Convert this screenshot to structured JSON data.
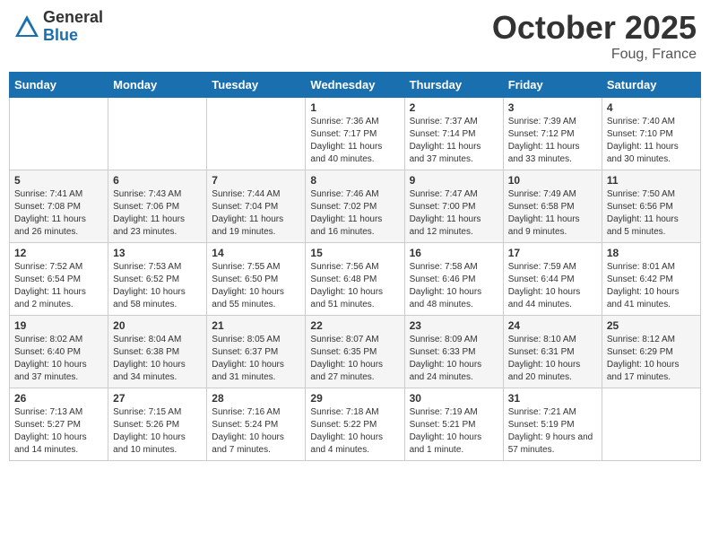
{
  "header": {
    "logo_general": "General",
    "logo_blue": "Blue",
    "title": "October 2025",
    "subtitle": "Foug, France"
  },
  "calendar": {
    "days_of_week": [
      "Sunday",
      "Monday",
      "Tuesday",
      "Wednesday",
      "Thursday",
      "Friday",
      "Saturday"
    ],
    "weeks": [
      [
        {
          "day": "",
          "info": ""
        },
        {
          "day": "",
          "info": ""
        },
        {
          "day": "",
          "info": ""
        },
        {
          "day": "1",
          "info": "Sunrise: 7:36 AM\nSunset: 7:17 PM\nDaylight: 11 hours and 40 minutes."
        },
        {
          "day": "2",
          "info": "Sunrise: 7:37 AM\nSunset: 7:14 PM\nDaylight: 11 hours and 37 minutes."
        },
        {
          "day": "3",
          "info": "Sunrise: 7:39 AM\nSunset: 7:12 PM\nDaylight: 11 hours and 33 minutes."
        },
        {
          "day": "4",
          "info": "Sunrise: 7:40 AM\nSunset: 7:10 PM\nDaylight: 11 hours and 30 minutes."
        }
      ],
      [
        {
          "day": "5",
          "info": "Sunrise: 7:41 AM\nSunset: 7:08 PM\nDaylight: 11 hours and 26 minutes."
        },
        {
          "day": "6",
          "info": "Sunrise: 7:43 AM\nSunset: 7:06 PM\nDaylight: 11 hours and 23 minutes."
        },
        {
          "day": "7",
          "info": "Sunrise: 7:44 AM\nSunset: 7:04 PM\nDaylight: 11 hours and 19 minutes."
        },
        {
          "day": "8",
          "info": "Sunrise: 7:46 AM\nSunset: 7:02 PM\nDaylight: 11 hours and 16 minutes."
        },
        {
          "day": "9",
          "info": "Sunrise: 7:47 AM\nSunset: 7:00 PM\nDaylight: 11 hours and 12 minutes."
        },
        {
          "day": "10",
          "info": "Sunrise: 7:49 AM\nSunset: 6:58 PM\nDaylight: 11 hours and 9 minutes."
        },
        {
          "day": "11",
          "info": "Sunrise: 7:50 AM\nSunset: 6:56 PM\nDaylight: 11 hours and 5 minutes."
        }
      ],
      [
        {
          "day": "12",
          "info": "Sunrise: 7:52 AM\nSunset: 6:54 PM\nDaylight: 11 hours and 2 minutes."
        },
        {
          "day": "13",
          "info": "Sunrise: 7:53 AM\nSunset: 6:52 PM\nDaylight: 10 hours and 58 minutes."
        },
        {
          "day": "14",
          "info": "Sunrise: 7:55 AM\nSunset: 6:50 PM\nDaylight: 10 hours and 55 minutes."
        },
        {
          "day": "15",
          "info": "Sunrise: 7:56 AM\nSunset: 6:48 PM\nDaylight: 10 hours and 51 minutes."
        },
        {
          "day": "16",
          "info": "Sunrise: 7:58 AM\nSunset: 6:46 PM\nDaylight: 10 hours and 48 minutes."
        },
        {
          "day": "17",
          "info": "Sunrise: 7:59 AM\nSunset: 6:44 PM\nDaylight: 10 hours and 44 minutes."
        },
        {
          "day": "18",
          "info": "Sunrise: 8:01 AM\nSunset: 6:42 PM\nDaylight: 10 hours and 41 minutes."
        }
      ],
      [
        {
          "day": "19",
          "info": "Sunrise: 8:02 AM\nSunset: 6:40 PM\nDaylight: 10 hours and 37 minutes."
        },
        {
          "day": "20",
          "info": "Sunrise: 8:04 AM\nSunset: 6:38 PM\nDaylight: 10 hours and 34 minutes."
        },
        {
          "day": "21",
          "info": "Sunrise: 8:05 AM\nSunset: 6:37 PM\nDaylight: 10 hours and 31 minutes."
        },
        {
          "day": "22",
          "info": "Sunrise: 8:07 AM\nSunset: 6:35 PM\nDaylight: 10 hours and 27 minutes."
        },
        {
          "day": "23",
          "info": "Sunrise: 8:09 AM\nSunset: 6:33 PM\nDaylight: 10 hours and 24 minutes."
        },
        {
          "day": "24",
          "info": "Sunrise: 8:10 AM\nSunset: 6:31 PM\nDaylight: 10 hours and 20 minutes."
        },
        {
          "day": "25",
          "info": "Sunrise: 8:12 AM\nSunset: 6:29 PM\nDaylight: 10 hours and 17 minutes."
        }
      ],
      [
        {
          "day": "26",
          "info": "Sunrise: 7:13 AM\nSunset: 5:27 PM\nDaylight: 10 hours and 14 minutes."
        },
        {
          "day": "27",
          "info": "Sunrise: 7:15 AM\nSunset: 5:26 PM\nDaylight: 10 hours and 10 minutes."
        },
        {
          "day": "28",
          "info": "Sunrise: 7:16 AM\nSunset: 5:24 PM\nDaylight: 10 hours and 7 minutes."
        },
        {
          "day": "29",
          "info": "Sunrise: 7:18 AM\nSunset: 5:22 PM\nDaylight: 10 hours and 4 minutes."
        },
        {
          "day": "30",
          "info": "Sunrise: 7:19 AM\nSunset: 5:21 PM\nDaylight: 10 hours and 1 minute."
        },
        {
          "day": "31",
          "info": "Sunrise: 7:21 AM\nSunset: 5:19 PM\nDaylight: 9 hours and 57 minutes."
        },
        {
          "day": "",
          "info": ""
        }
      ]
    ]
  }
}
